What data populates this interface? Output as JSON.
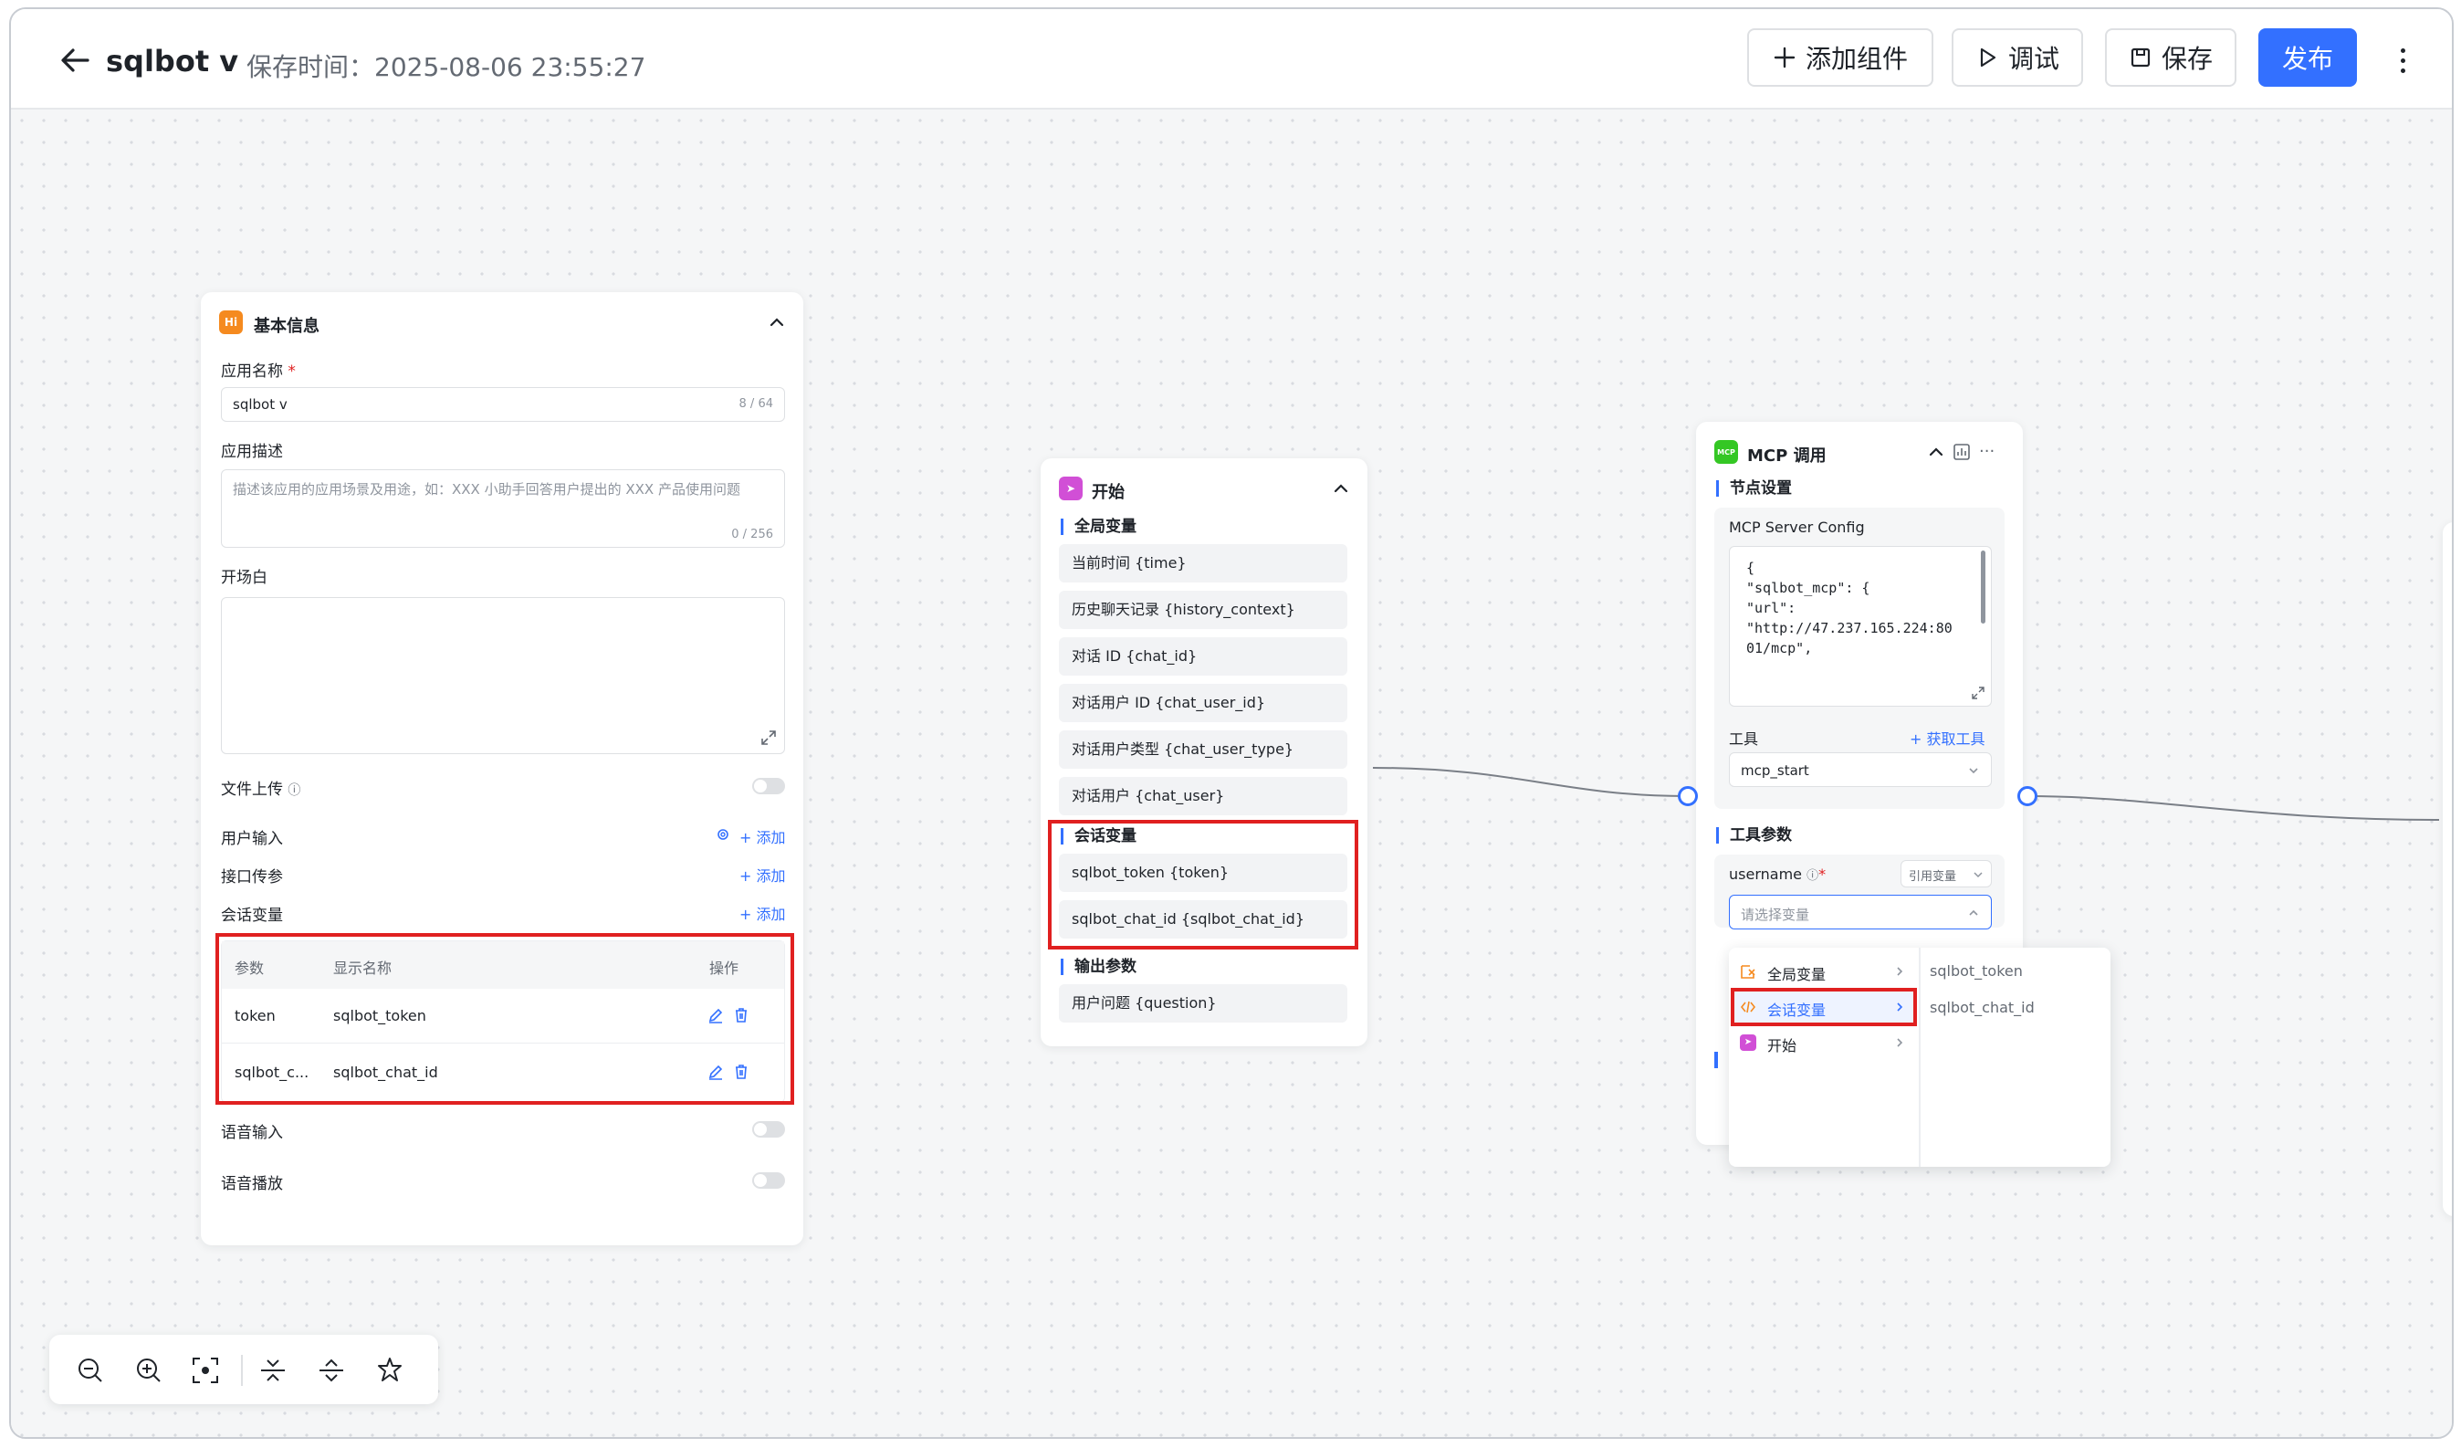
{
  "header": {
    "app_title": "sqlbot v",
    "save_time": "保存时间：2025-08-06 23:55:27",
    "add_component": "添加组件",
    "debug": "调试",
    "save": "保存",
    "publish": "发布"
  },
  "basic_panel": {
    "title": "基本信息",
    "app_name_label": "应用名称",
    "app_name_value": "sqlbot v",
    "app_name_count": "8 / 64",
    "app_desc_label": "应用描述",
    "app_desc_placeholder": "描述该应用的应用场景及用途，如：XXX 小助手回答用户提出的 XXX 产品使用问题",
    "app_desc_count": "0 / 256",
    "opening_label": "开场白",
    "file_upload_label": "文件上传",
    "user_input_label": "用户输入",
    "api_param_label": "接口传参",
    "session_var_label": "会话变量",
    "add": "添加",
    "table_headers": [
      "参数",
      "显示名称",
      "操作"
    ],
    "rows": [
      {
        "param": "token",
        "display": "sqlbot_token"
      },
      {
        "param": "sqlbot_c...",
        "display": "sqlbot_chat_id"
      }
    ],
    "voice_input_label": "语音输入",
    "voice_play_label": "语音播放"
  },
  "start_panel": {
    "title": "开始",
    "global_vars_label": "全局变量",
    "global_vars": [
      "当前时间 {time}",
      "历史聊天记录 {history_context}",
      "对话 ID {chat_id}",
      "对话用户 ID {chat_user_id}",
      "对话用户类型 {chat_user_type}",
      "对话用户 {chat_user}"
    ],
    "session_vars_label": "会话变量",
    "session_vars": [
      "sqlbot_token {token}",
      "sqlbot_chat_id {sqlbot_chat_id}"
    ],
    "output_label": "输出参数",
    "outputs": [
      "用户问题 {question}"
    ]
  },
  "mcp_panel": {
    "title": "MCP 调用",
    "icon_text": "MCP",
    "node_settings": "节点设置",
    "server_config_label": "MCP Server Config",
    "config_lines": [
      "{",
      "\"sqlbot_mcp\": {",
      "\"url\":",
      "\"http://47.237.165.224:80",
      "01/mcp\","
    ],
    "tool_label": "工具",
    "get_tools": "获取工具",
    "tool_value": "mcp_start",
    "tool_params": "工具参数",
    "username_label": "username",
    "ref_var": "引用变量",
    "select_placeholder": "请选择变量"
  },
  "dropdown": {
    "left": [
      "全局变量",
      "会话变量",
      "开始"
    ],
    "right": [
      "sqlbot_token",
      "sqlbot_chat_id"
    ]
  },
  "colors": {
    "accent": "#3370ff",
    "highlight": "#e02020",
    "basic_icon": "#f58a1f",
    "start_icon": "#d14fd6",
    "mcp_icon": "#34c724"
  }
}
